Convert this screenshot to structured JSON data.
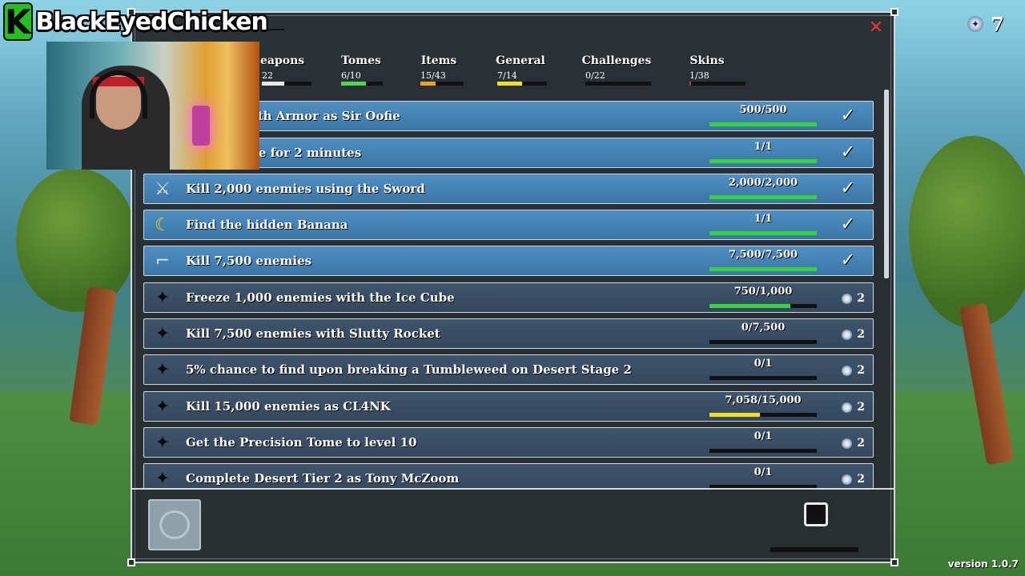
{
  "overlay": {
    "logo_letter": "K",
    "channel_name": "BlackEyedChicken"
  },
  "hud": {
    "currency_count": "7",
    "version": "version 1.0.7"
  },
  "tabs": [
    {
      "label": "Weapons",
      "visible_label": "eapons",
      "count": "22",
      "progress": 0.45,
      "color": "#e8e8e8"
    },
    {
      "label": "Tomes",
      "count": "6/10",
      "progress": 0.6,
      "color": "#4fd64a"
    },
    {
      "label": "Items",
      "count": "15/43",
      "progress": 0.35,
      "color": "#f0a020"
    },
    {
      "label": "General",
      "count": "7/14",
      "progress": 0.5,
      "color": "#f0e020"
    },
    {
      "label": "Challenges",
      "count": "0/22",
      "progress": 0.0,
      "color": "#4fd64a"
    },
    {
      "label": "Skins",
      "count": "1/38",
      "progress": 0.03,
      "color": "#e03020"
    }
  ],
  "quests": [
    {
      "text": "damage with Armor as Sir Oofie",
      "progress_text": "500/500",
      "progress": 1.0,
      "done": true,
      "icon": "armor-icon"
    },
    {
      "text": "any damage for 2 minutes",
      "progress_text": "1/1",
      "progress": 1.0,
      "done": true,
      "icon": "shield-icon"
    },
    {
      "text": "Kill 2,000 enemies using the Sword",
      "progress_text": "2,000/2,000",
      "progress": 1.0,
      "done": true,
      "icon": "sword-icon"
    },
    {
      "text": "Find the hidden Banana",
      "progress_text": "1/1",
      "progress": 1.0,
      "done": true,
      "icon": "banana-icon"
    },
    {
      "text": "Kill 7,500 enemies",
      "progress_text": "7,500/7,500",
      "progress": 1.0,
      "done": true,
      "icon": "revolver-icon"
    },
    {
      "text": "Freeze 1,000 enemies with the Ice Cube",
      "progress_text": "750/1,000",
      "progress": 0.75,
      "done": false,
      "reward": "2",
      "icon": "locked-icon"
    },
    {
      "text": "Kill 7,500 enemies with Slutty Rocket",
      "progress_text": "0/7,500",
      "progress": 0.0,
      "done": false,
      "reward": "2",
      "icon": "locked-icon"
    },
    {
      "text": "5% chance to find upon breaking a Tumbleweed on Desert Stage 2",
      "progress_text": "0/1",
      "progress": 0.0,
      "done": false,
      "reward": "2",
      "icon": "locked-icon"
    },
    {
      "text": "Kill 15,000 enemies as CL4NK",
      "progress_text": "7,058/15,000",
      "progress": 0.47,
      "done": false,
      "reward": "2",
      "icon": "locked-icon"
    },
    {
      "text": "Get the Precision Tome to level 10",
      "progress_text": "0/1",
      "progress": 0.0,
      "done": false,
      "reward": "2",
      "icon": "locked-icon"
    },
    {
      "text": "Complete Desert Tier 2 as Tony McZoom",
      "progress_text": "0/1",
      "progress": 0.0,
      "done": false,
      "reward": "2",
      "icon": "locked-icon"
    }
  ],
  "colors": {
    "complete_bar": "#34d43a",
    "partial_bar_high": "#34d43a",
    "partial_bar_mid": "#f0e020",
    "close": "#e8382e"
  }
}
